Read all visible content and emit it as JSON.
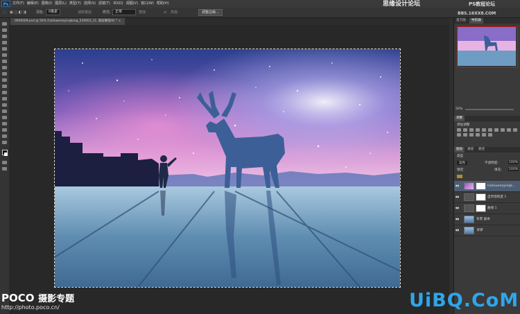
{
  "app": {
    "logo": "Ps",
    "menus": [
      "文件(F)",
      "编辑(E)",
      "图像(I)",
      "图层(L)",
      "类型(Y)",
      "选择(S)",
      "滤镜(T)",
      "3D(D)",
      "视图(V)",
      "窗口(W)",
      "帮助(H)"
    ],
    "watermark_top": "思缘设计论坛",
    "watermark_top2": "PS教程论坛",
    "watermark_top3": "BBS.16XX8.COM"
  },
  "options": {
    "feather_label": "羽化:",
    "feather_value": "0像素",
    "antialias_label": "消除锯齿",
    "style_label": "样式:",
    "style_value": "正常",
    "width_label": "宽度:",
    "height_label": "高度:",
    "refine_button": "调整边缘..."
  },
  "document": {
    "tab_title": "0000009.psd @ 50% (halloweenpinqkong_526903_11, 图层蒙版/8) * ×"
  },
  "panels": {
    "top_tabs": [
      "直方图",
      "导航器"
    ],
    "zoom": "50%",
    "adjust_tab": "调整",
    "adjust_title": "添加调整",
    "layers_tabs": [
      "图层",
      "通道",
      "路径"
    ],
    "kind_label": "类型",
    "blend_mode": "滤色",
    "opacity_label": "不透明度:",
    "opacity_value": "100%",
    "lock_label": "锁定:",
    "fill_label": "填充:",
    "fill_value": "100%",
    "layers": [
      {
        "name": "halloweenpinqk..."
      },
      {
        "name": "自然饱和度 1"
      },
      {
        "name": "曲线 1"
      },
      {
        "name": "背景 副本"
      },
      {
        "name": "背景"
      }
    ]
  },
  "bottom_watermark": {
    "brand": "POCO",
    "brand_cn": "摄影专题",
    "url": "http://photo.poco.cn/",
    "site": "UiBQ.CoM"
  },
  "colors": {
    "accent_blue": "#2fa6e9",
    "selected_layer": "#4e5d72"
  }
}
